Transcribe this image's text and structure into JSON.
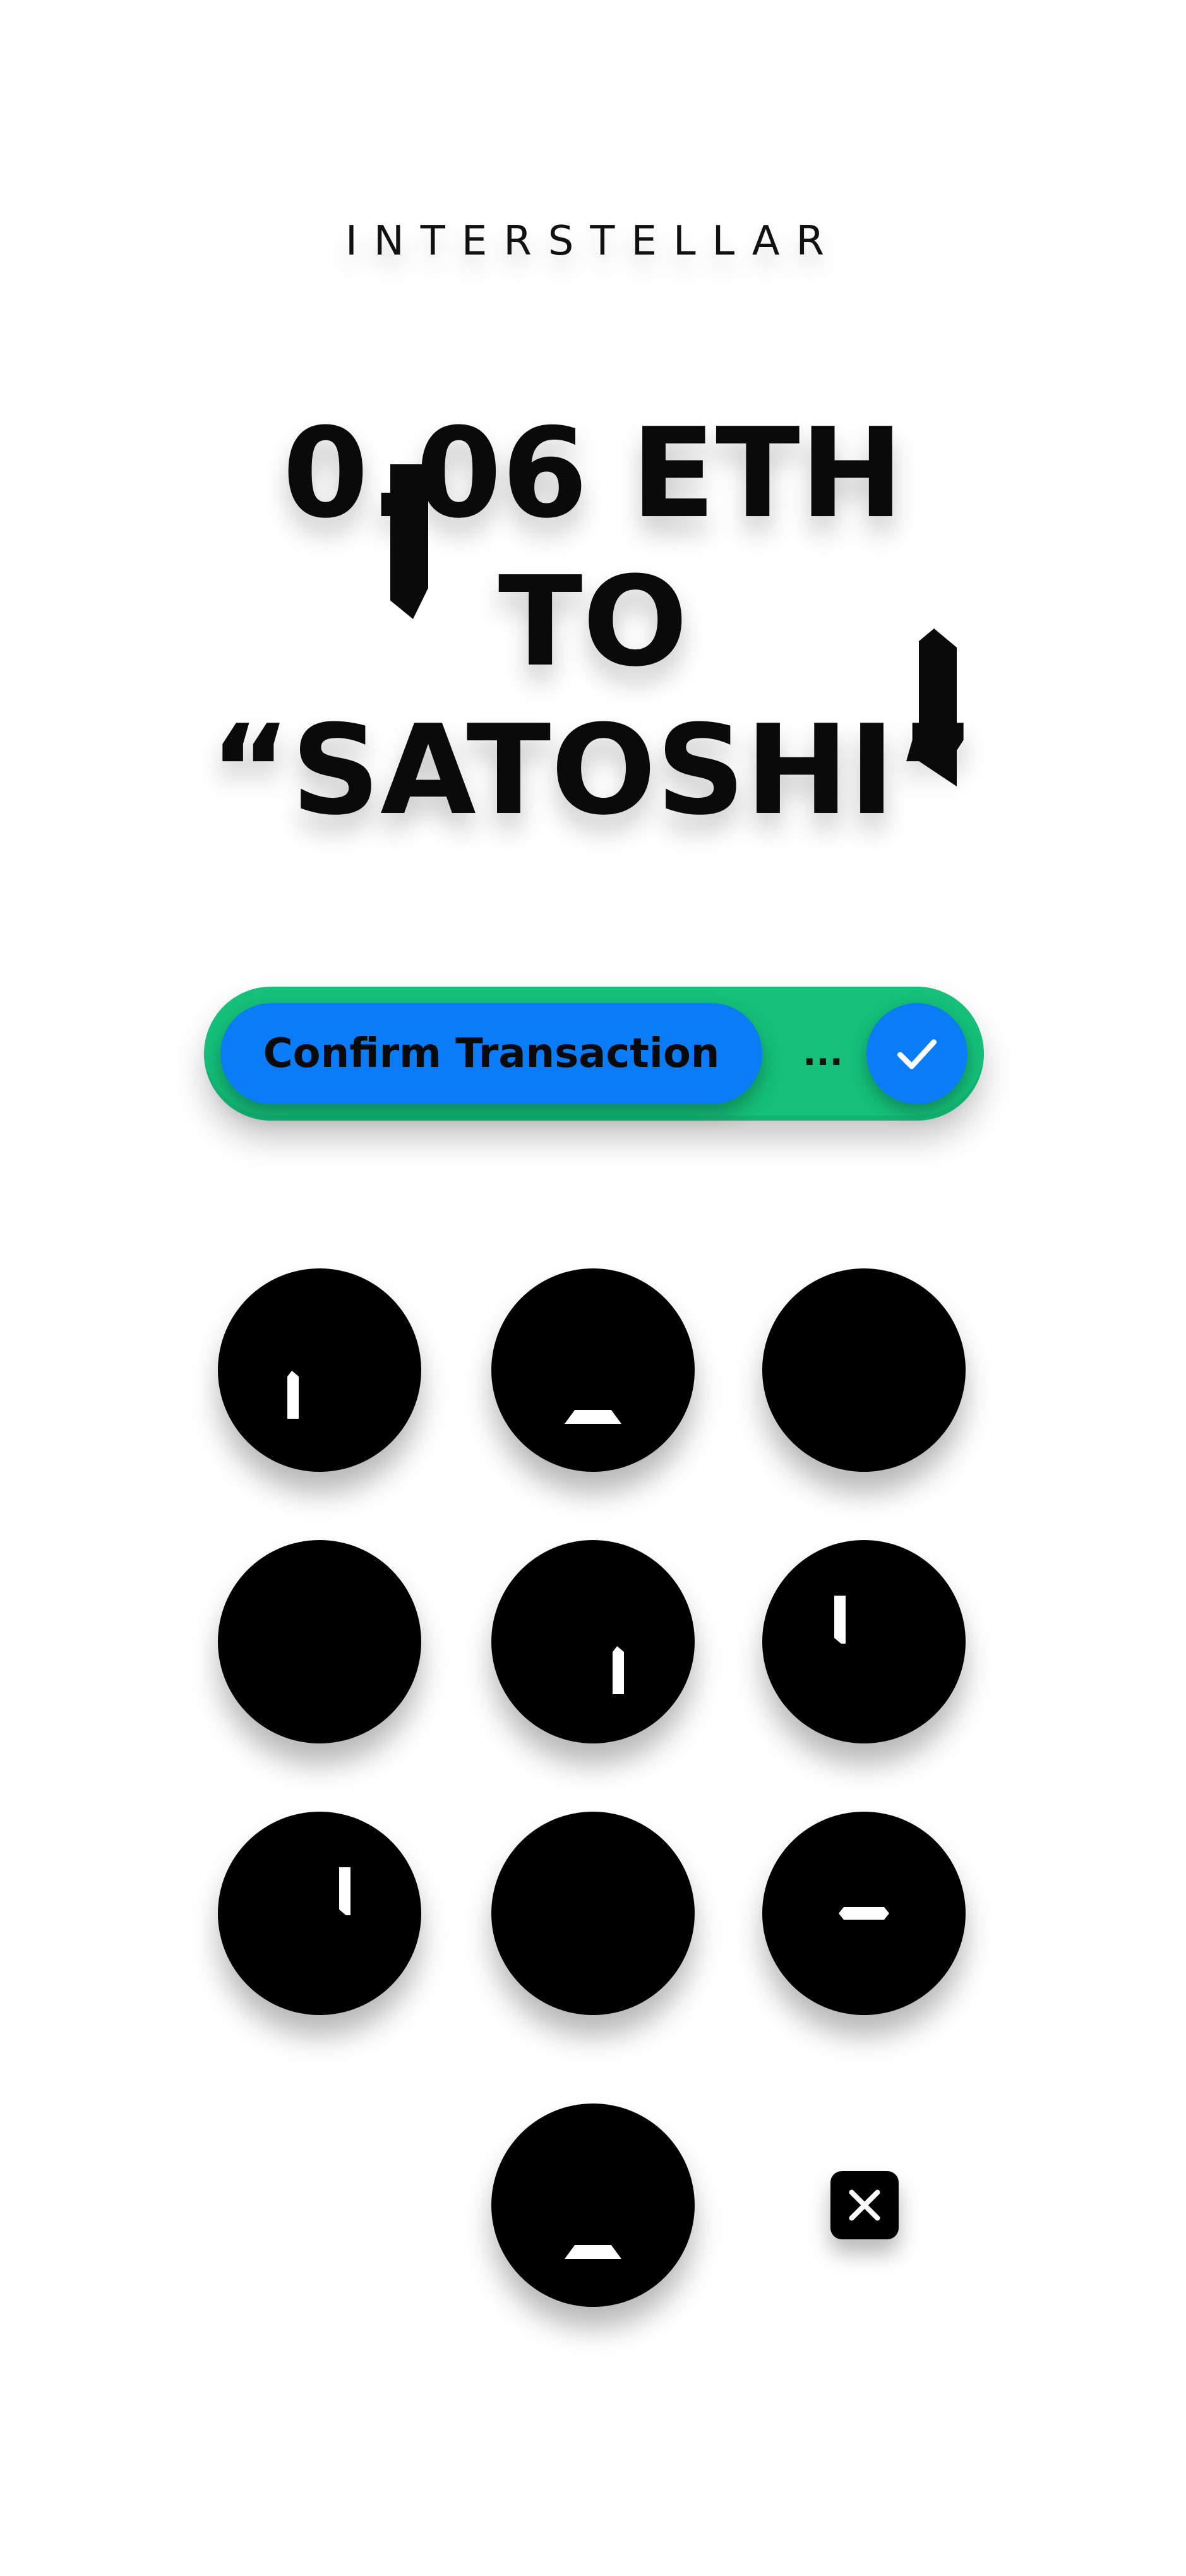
{
  "brand": {
    "name": "INTERSTELLAR"
  },
  "transaction": {
    "line1": "0.06 ETH",
    "line2": "TO",
    "line3": "“SATOSHI”"
  },
  "slider": {
    "confirm_label": "Confirm Transaction",
    "progress_indicator": "...",
    "check_icon": "check-icon",
    "colors": {
      "track": "#14c07a",
      "button": "#0a7cf7"
    }
  },
  "keypad": {
    "keys": [
      {
        "name": "key-1",
        "glyph": "vertical-stroke"
      },
      {
        "name": "key-2",
        "glyph": "base-stroke"
      },
      {
        "name": "key-3",
        "glyph": "none"
      },
      {
        "name": "key-4",
        "glyph": "none"
      },
      {
        "name": "key-5",
        "glyph": "vertical-stroke"
      },
      {
        "name": "key-6",
        "glyph": "vertical-stroke"
      },
      {
        "name": "key-7",
        "glyph": "vertical-stroke"
      },
      {
        "name": "key-8",
        "glyph": "none"
      },
      {
        "name": "key-9",
        "glyph": "dash-stroke"
      },
      {
        "name": "key-0",
        "glyph": "base-stroke"
      }
    ],
    "delete_icon": "close-icon"
  }
}
